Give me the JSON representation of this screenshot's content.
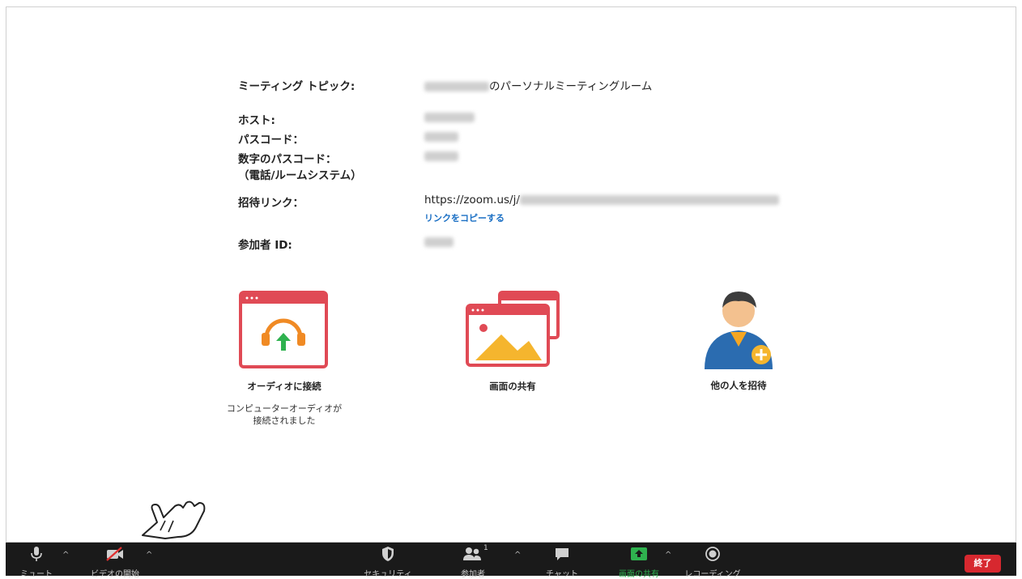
{
  "meeting": {
    "topic_label": "ミーティング トピック:",
    "topic_value": "のパーソナルミーティングルーム",
    "host_label": "ホスト:",
    "passcode_label": "パスコード：",
    "numeric_passcode_label": "数字のパスコード：",
    "numeric_passcode_sub": "（電話/ルームシステム）",
    "invite_link_label": "招待リンク：",
    "invite_link_value": "https://zoom.us/j/",
    "copy_link": "リンクをコピーする",
    "participant_id_label": "参加者 ID:"
  },
  "actions": {
    "audio": {
      "label": "オーディオに接続",
      "status": "コンピューターオーディオが接続されました"
    },
    "share": {
      "label": "画面の共有"
    },
    "invite": {
      "label": "他の人を招待"
    }
  },
  "toolbar": {
    "mute": "ミュート",
    "video": "ビデオの開始",
    "security": "セキュリティ",
    "participants": "参加者",
    "participants_count": "1",
    "chat": "チャット",
    "share_screen": "画面の共有",
    "record": "レコーディング",
    "end": "終了"
  },
  "colors": {
    "toolbar_bg": "#1a1a1a",
    "share_green": "#2fb24f",
    "end_red": "#d7282f",
    "icon_red": "#e04a55",
    "link_blue": "#1a6fc4"
  }
}
